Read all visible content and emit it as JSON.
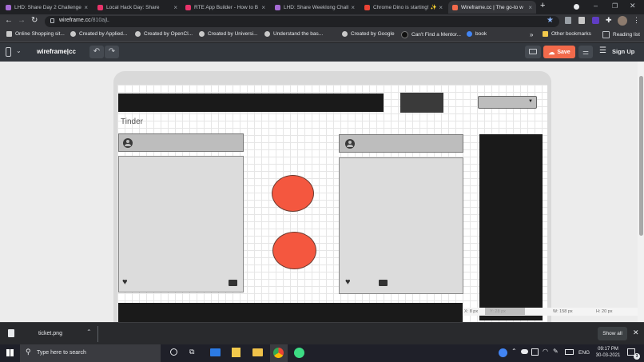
{
  "browser": {
    "tabs": [
      {
        "title": "LHD: Share Day 2 Challenge",
        "color": "#a56bd4"
      },
      {
        "title": "Local Hack Day: Share",
        "color": "#e8336a"
      },
      {
        "title": "RTE App Builder - How to B",
        "color": "#e8336a"
      },
      {
        "title": "LHD: Share Weeklong Chall",
        "color": "#a56bd4"
      },
      {
        "title": "Chrome Dino is starting! ✨",
        "color": "#ea4335"
      },
      {
        "title": "Wireframe.cc | The go-to w",
        "color": "#f26a4b"
      }
    ],
    "new_tab": "+",
    "url_domain": "wireframe.cc",
    "url_path": "/810ajL",
    "bookmarks": [
      "Online Shopping sit...",
      "Created by Applied...",
      "Created by OpenCl...",
      "Created by Universi...",
      "Understand the bas...",
      "Created by Google",
      "Can't Find a Mentor...",
      "book"
    ],
    "overflow": "»",
    "other_bookmarks": "Other bookmarks",
    "reading_list": "Reading list"
  },
  "app": {
    "logo": "wireframe|cc",
    "save_label": "Save",
    "signup_label": "Sign Up"
  },
  "canvas": {
    "heading": "Tinder",
    "status": {
      "x": "X: 8 px",
      "y": "Y: 28 px",
      "w": "W: 158 px",
      "h": "H: 20 px"
    }
  },
  "downloads": {
    "file": "ticket.png",
    "show_all": "Show all"
  },
  "taskbar": {
    "search_placeholder": "Type here to search",
    "lang": "ENG",
    "time": "09:17 PM",
    "date": "30-03-2021",
    "notif_count": "3"
  },
  "colors": {
    "accent_save": "#f26a4b",
    "circle": "#f4573f"
  }
}
